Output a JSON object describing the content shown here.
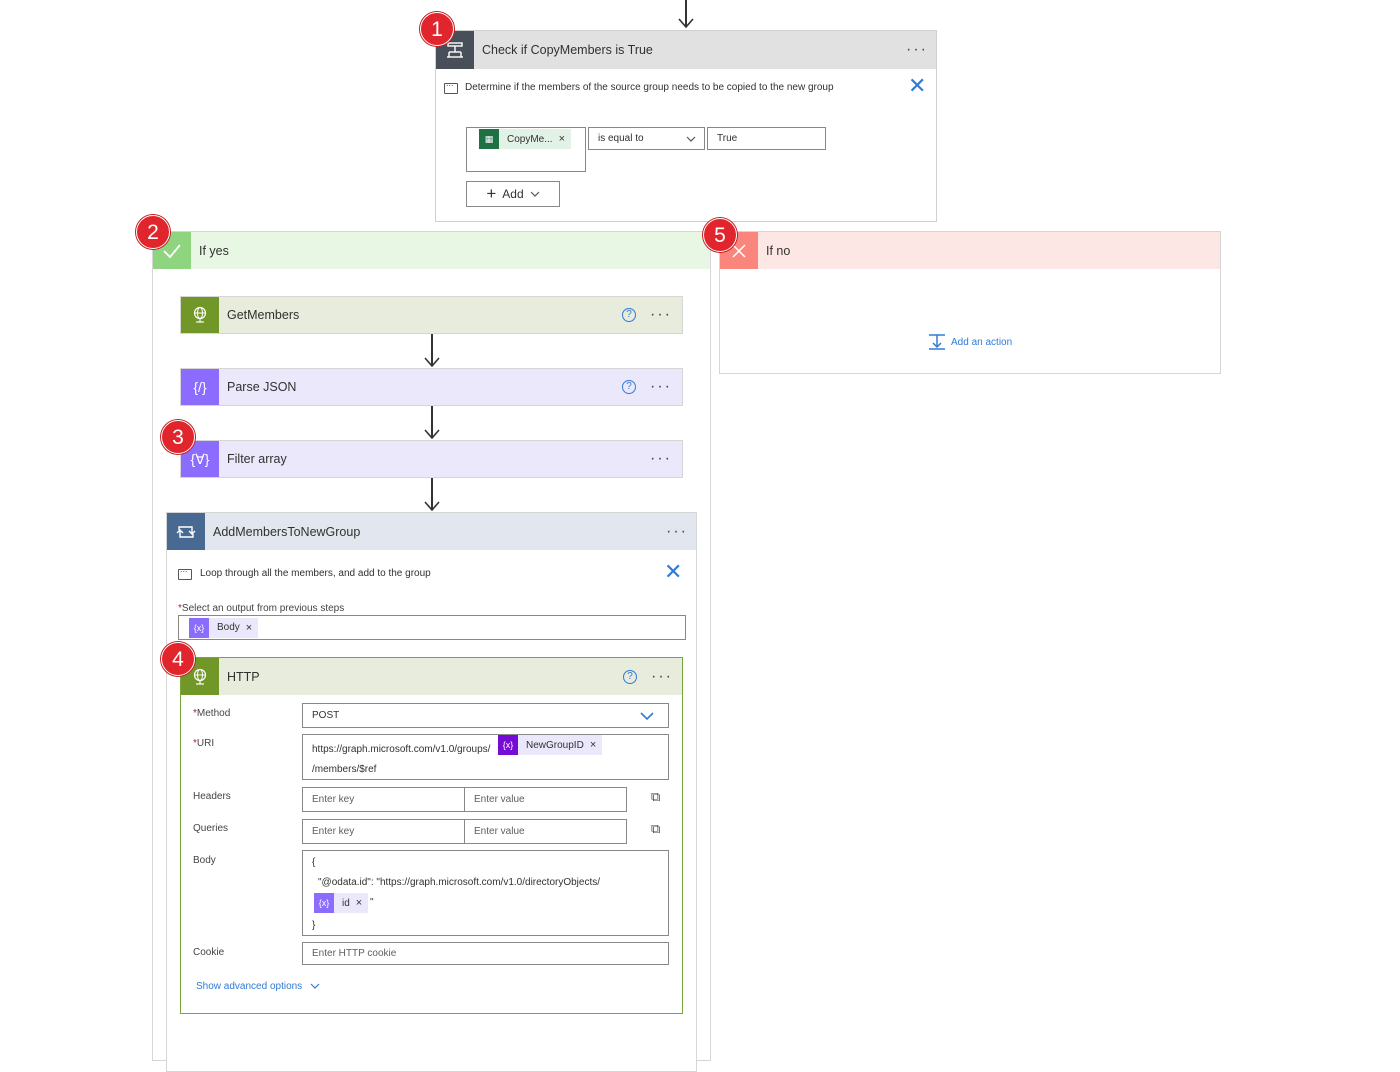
{
  "condition": {
    "badge": "1",
    "title": "Check if CopyMembers is True",
    "comment": "Determine if the members of the source group needs to be copied to the new group",
    "token_label": "CopyMe...",
    "operator": "is equal to",
    "value": "True",
    "add_label": "Add"
  },
  "if_yes": {
    "badge": "2",
    "label": "If yes",
    "actions": [
      {
        "title": "GetMembers"
      },
      {
        "title": "Parse JSON"
      },
      {
        "title": "Filter array",
        "badge": "3"
      }
    ],
    "loop": {
      "title": "AddMembersToNewGroup",
      "comment": "Loop through all the members, and add to the group",
      "select_label": "Select an output from previous steps",
      "select_token": "Body",
      "required_mark": "*"
    },
    "http": {
      "badge": "4",
      "title": "HTTP",
      "method_label": "Method",
      "method_value": "POST",
      "uri_label": "URI",
      "uri_prefix": "https://graph.microsoft.com/v1.0/groups/",
      "uri_token": "NewGroupID",
      "uri_suffix": "/members/$ref",
      "headers_label": "Headers",
      "queries_label": "Queries",
      "key_placeholder": "Enter key",
      "value_placeholder": "Enter value",
      "body_label": "Body",
      "body_line1": "{",
      "body_line2": "\"@odata.id\": \"https://graph.microsoft.com/v1.0/directoryObjects/",
      "body_token": "id",
      "body_token_suffix": "\"",
      "body_line4": "}",
      "cookie_label": "Cookie",
      "cookie_placeholder": "Enter HTTP cookie",
      "advanced_label": "Show advanced options"
    }
  },
  "if_no": {
    "badge": "5",
    "label": "If no",
    "add_action": "Add an action"
  },
  "colors": {
    "condition_header": "#e1e1e1",
    "condition_icon": "#484f58",
    "yes_header": "#e8f6e4",
    "yes_icon": "#8fd47f",
    "no_header": "#fde7e5",
    "no_icon": "#f9857c",
    "http_header": "#e7ecdc",
    "http_icon": "#709727",
    "data_header": "#ebe8fc",
    "data_icon": "#8c6cff",
    "loop_header": "#e2e7ef",
    "loop_icon": "#486991",
    "badge": "#e0262c",
    "link": "#2f7bd6"
  }
}
